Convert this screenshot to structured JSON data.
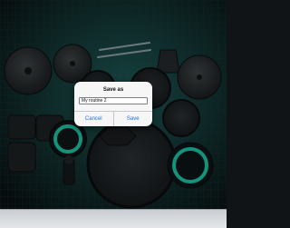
{
  "dialog": {
    "title": "Save as",
    "input_value": "My routine 2",
    "cancel_label": "Cancel",
    "ok_label": "Save"
  },
  "icons": [
    "cymbal-icon",
    "tom-drum-icon",
    "snare-drum-icon",
    "bass-drum-icon",
    "drum-pad-icon",
    "drumsticks-icon",
    "cowbell-icon",
    "pedal-icon"
  ],
  "colors": {
    "accent": "#1fd6b4",
    "dialog_button": "#1d6fe0",
    "background": "#111417"
  }
}
